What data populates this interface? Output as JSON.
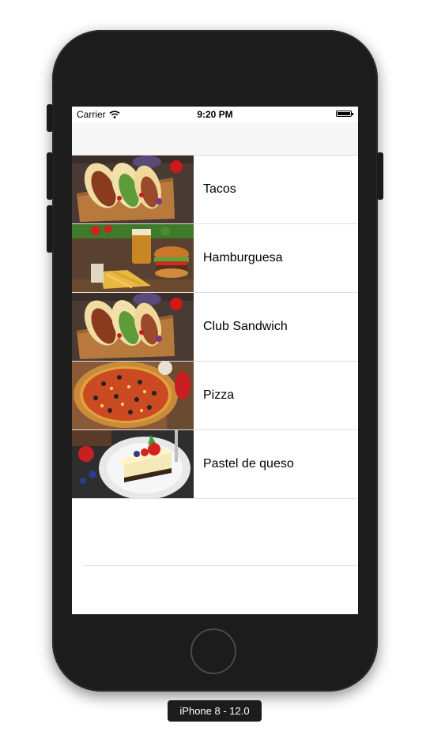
{
  "status_bar": {
    "carrier": "Carrier",
    "time": "9:20 PM"
  },
  "items": [
    {
      "label": "Tacos",
      "image": "tacos"
    },
    {
      "label": "Hamburguesa",
      "image": "burger"
    },
    {
      "label": "Club Sandwich",
      "image": "tacos"
    },
    {
      "label": "Pizza",
      "image": "pizza"
    },
    {
      "label": "Pastel de queso",
      "image": "cheesecake"
    }
  ],
  "device_label": "iPhone 8 - 12.0"
}
